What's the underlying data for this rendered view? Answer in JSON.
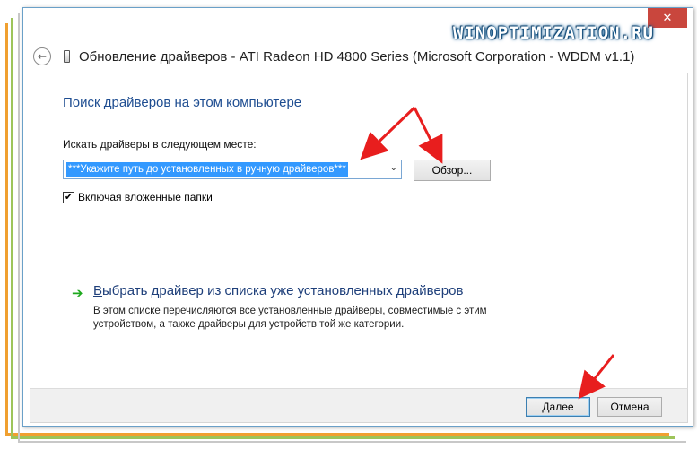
{
  "window": {
    "close_glyph": "✕",
    "title": "Обновление драйверов - ATI Radeon HD 4800 Series (Microsoft Corporation - WDDM v1.1)",
    "back_glyph": "←"
  },
  "watermark": "WINOPTIMIZATION.RU",
  "page": {
    "title": "Поиск драйверов на этом компьютере",
    "search_label": "Искать драйверы в следующем месте:",
    "path_value": "***Укажите путь до установленных в ручную драйверов***",
    "combo_arrow": "⌄",
    "browse_label": "Обзор...",
    "include_subfolders": {
      "label": "Включая вложенные папки",
      "checked": true,
      "check_glyph": "✔"
    },
    "choose": {
      "arrow_glyph": "➔",
      "title": "Выбрать драйвер из списка уже установленных драйверов",
      "description": "В этом списке перечисляются все установленные драйверы, совместимые с этим устройством, а также драйверы для устройств той же категории."
    }
  },
  "footer": {
    "next_label": "Далее",
    "cancel_label": "Отмена"
  },
  "colors": {
    "link_blue": "#1e4d91",
    "selection": "#3399ff",
    "close_red": "#c9463d",
    "annotation_red": "#e81e1e",
    "green_arrow": "#1ea81e"
  },
  "icons": [
    "back-arrow-icon",
    "device-icon",
    "chevron-down-icon",
    "checkmark-icon",
    "green-arrow-icon",
    "close-icon"
  ]
}
